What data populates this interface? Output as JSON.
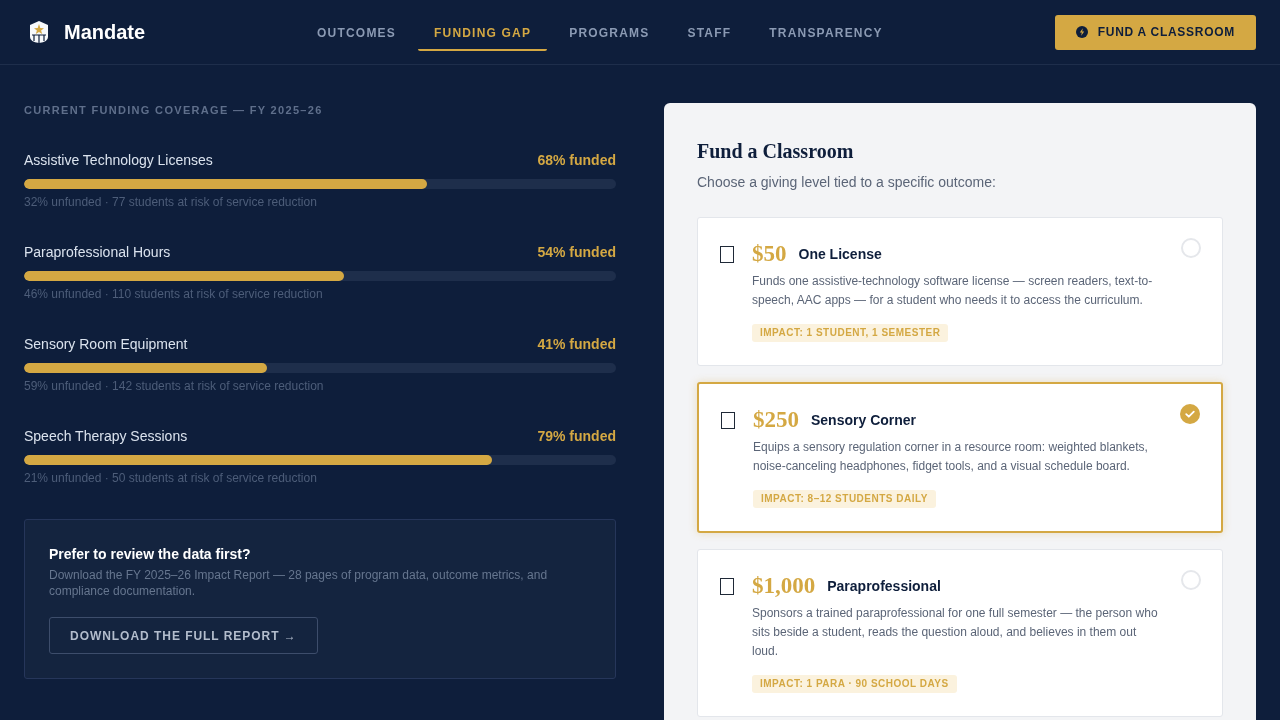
{
  "brand": {
    "name": "Mandate"
  },
  "nav": [
    {
      "label": "OUTCOMES",
      "selected": false
    },
    {
      "label": "FUNDING GAP",
      "selected": true
    },
    {
      "label": "PROGRAMS",
      "selected": false
    },
    {
      "label": "STAFF",
      "selected": false
    },
    {
      "label": "TRANSPARENCY",
      "selected": false
    }
  ],
  "cta_button": {
    "label": "FUND A CLASSROOM"
  },
  "coverage": {
    "heading": "CURRENT FUNDING COVERAGE — FY 2025–26",
    "items": [
      {
        "name": "Assistive Technology Licenses",
        "funded": "68% funded",
        "level": 0.68,
        "note": "32% unfunded · 77 students at risk of service reduction"
      },
      {
        "name": "Paraprofessional Hours",
        "funded": "54% funded",
        "level": 0.54,
        "note": "46% unfunded · 110 students at risk of service reduction"
      },
      {
        "name": "Sensory Room Equipment",
        "funded": "41% funded",
        "level": 0.41,
        "note": "59% unfunded · 142 students at risk of service reduction"
      },
      {
        "name": "Speech Therapy Sessions",
        "funded": "79% funded",
        "level": 0.79,
        "note": "21% unfunded · 50 students at risk of service reduction"
      }
    ]
  },
  "report_card": {
    "title": "Prefer to review the data first?",
    "text": "Download the FY 2025–26 Impact Report — 28 pages of program data, outcome metrics, and compliance documentation.",
    "button": "DOWNLOAD THE FULL REPORT →"
  },
  "fund_panel": {
    "title": "Fund a Classroom",
    "subtitle": "Choose a giving level tied to a specific outcome:",
    "options": [
      {
        "price": "$50",
        "name": "One License",
        "description": "Funds one assistive-technology software license — screen readers, text-to-speech, AAC apps — for a student who needs it to access the curriculum.",
        "impact": "IMPACT: 1 STUDENT, 1 SEMESTER",
        "selected": false
      },
      {
        "price": "$250",
        "name": "Sensory Corner",
        "description": "Equips a sensory regulation corner in a resource room: weighted blankets, noise-canceling headphones, fidget tools, and a visual schedule board.",
        "impact": "IMPACT: 8–12 STUDENTS DAILY",
        "selected": true
      },
      {
        "price": "$1,000",
        "name": "Paraprofessional",
        "description": "Sponsors a trained paraprofessional for one full semester — the person who sits beside a student, reads the question aloud, and believes in them out loud.",
        "impact": "IMPACT: 1 PARA · 90 SCHOOL DAYS",
        "selected": false
      }
    ]
  }
}
